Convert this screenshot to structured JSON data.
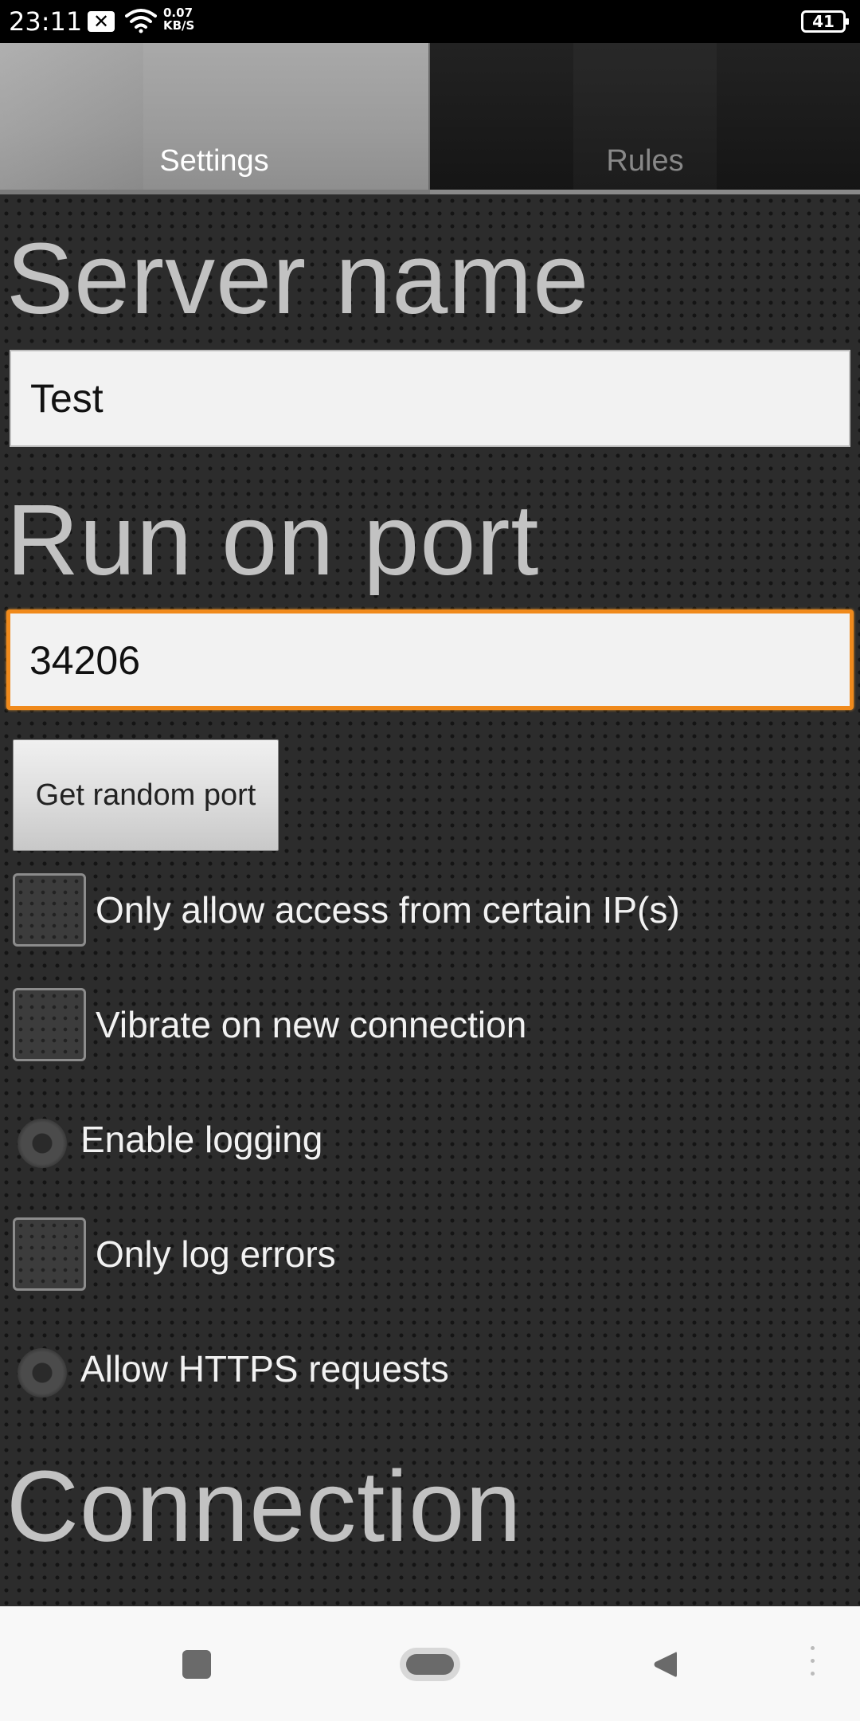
{
  "status_bar": {
    "time": "23:11",
    "notification_icon": "close-box-icon",
    "wifi_icon": "wifi-icon",
    "speed_value": "0.07",
    "speed_unit": "KB/S",
    "battery": "41"
  },
  "tabs": [
    {
      "label": "Settings",
      "active": true
    },
    {
      "label": "Rules",
      "active": false
    }
  ],
  "settings": {
    "server_name_heading": "Server name",
    "server_name_value": "Test",
    "port_heading": "Run on port",
    "port_value": "34206",
    "random_port_button": "Get random port",
    "options": [
      {
        "label": "Only allow access from certain IP(s)",
        "type": "checkbox",
        "checked": false
      },
      {
        "label": "Vibrate on new connection",
        "type": "checkbox",
        "checked": false
      },
      {
        "label": "Enable logging",
        "type": "radio",
        "checked": false
      },
      {
        "label": "Only log errors",
        "type": "checkbox",
        "checked": false
      },
      {
        "label": "Allow HTTPS requests",
        "type": "radio",
        "checked": false
      }
    ],
    "connection_heading": "Connection"
  },
  "nav_bar": {
    "recents_icon": "recents-square-icon",
    "home_icon": "home-pill-icon",
    "back_icon": "back-triangle-icon",
    "menu_icon": "more-vertical-icon"
  },
  "colors": {
    "focus_accent": "#f08a1c",
    "heading_text": "#c2c2c2",
    "background": "#2c2c2c"
  }
}
